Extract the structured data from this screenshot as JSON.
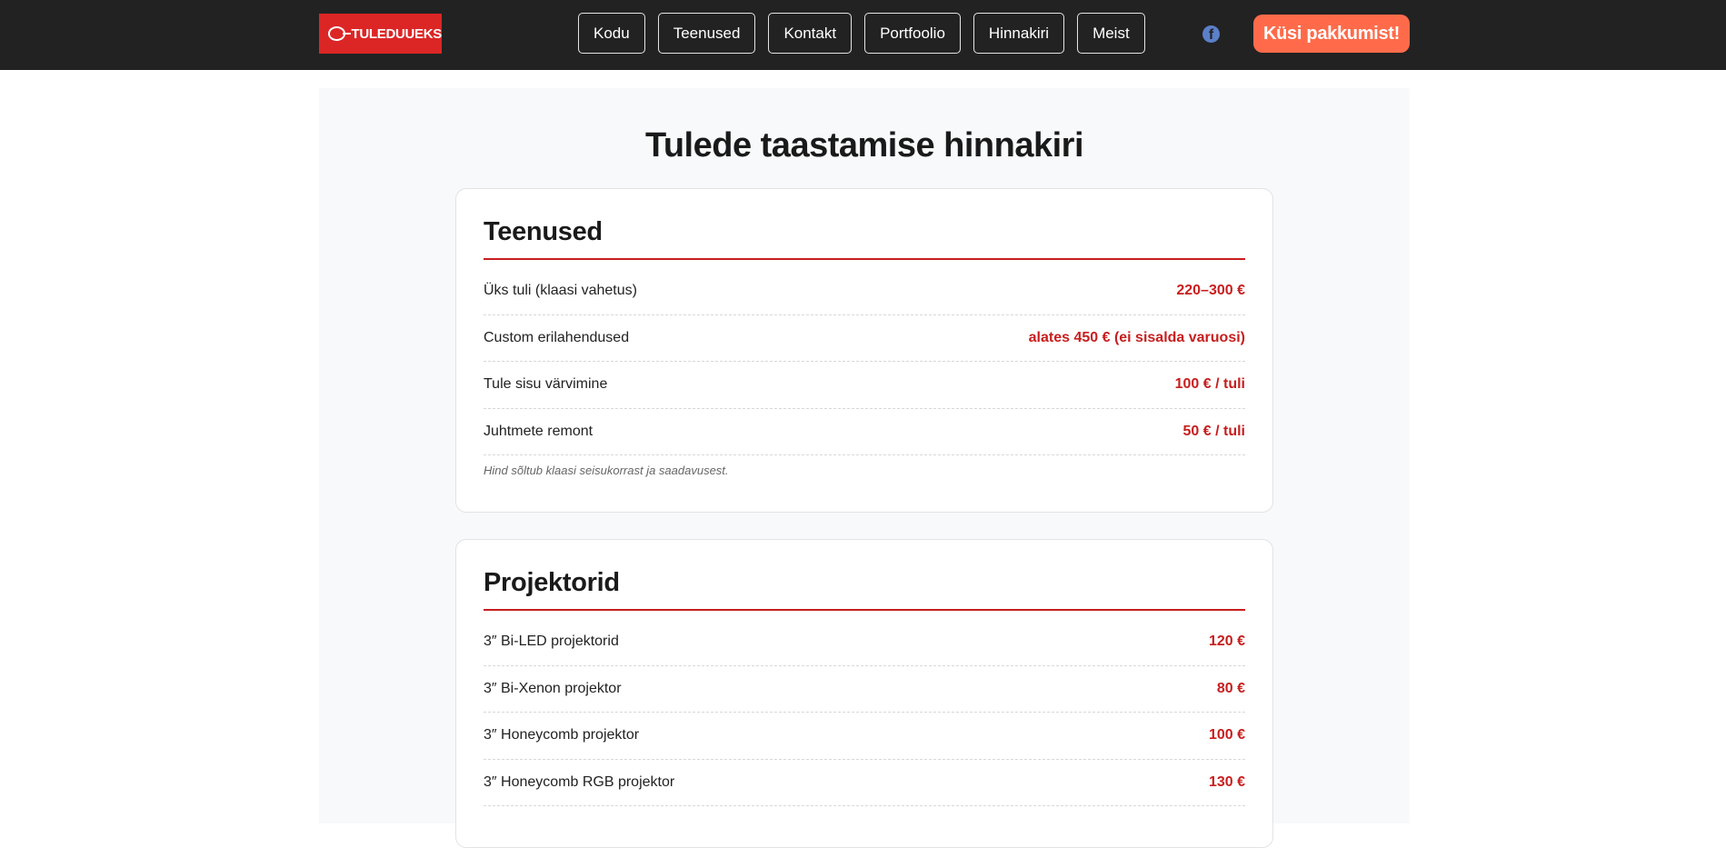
{
  "header": {
    "logo_text": "TULEDUUEKS",
    "nav": [
      {
        "label": "Kodu"
      },
      {
        "label": "Teenused"
      },
      {
        "label": "Kontakt"
      },
      {
        "label": "Portfoolio"
      },
      {
        "label": "Hinnakiri"
      },
      {
        "label": "Meist"
      }
    ],
    "facebook_glyph": "f",
    "cta_label": "Küsi pakkumist!"
  },
  "main": {
    "title": "Tulede taastamise hinnakiri",
    "sections": [
      {
        "title": "Teenused",
        "rows": [
          {
            "name": "Üks tuli (klaasi vahetus)",
            "price": "220–300 €"
          },
          {
            "name": "Custom erilahendused",
            "price": "alates 450 € (ei sisalda varuosi)"
          },
          {
            "name": "Tule sisu värvimine",
            "price": "100 € / tuli"
          },
          {
            "name": "Juhtmete remont",
            "price": "50 € / tuli"
          }
        ],
        "note": "Hind sõltub klaasi seisukorrast ja saadavusest."
      },
      {
        "title": "Projektorid",
        "rows": [
          {
            "name": "3″ Bi-LED projektorid",
            "price": "120 €"
          },
          {
            "name": "3″ Bi-Xenon projektor",
            "price": "80 €"
          },
          {
            "name": "3″ Honeycomb projektor",
            "price": "100 €"
          },
          {
            "name": "3″ Honeycomb RGB projektor",
            "price": "130 €"
          }
        ]
      }
    ]
  },
  "colors": {
    "header_bg": "#222222",
    "logo_bg": "#dc2626",
    "cta_bg": "#ff6b4a",
    "accent_red": "#c81e1e",
    "facebook_blue": "#5b7fc9"
  },
  "icons": {
    "facebook": "facebook-icon"
  }
}
